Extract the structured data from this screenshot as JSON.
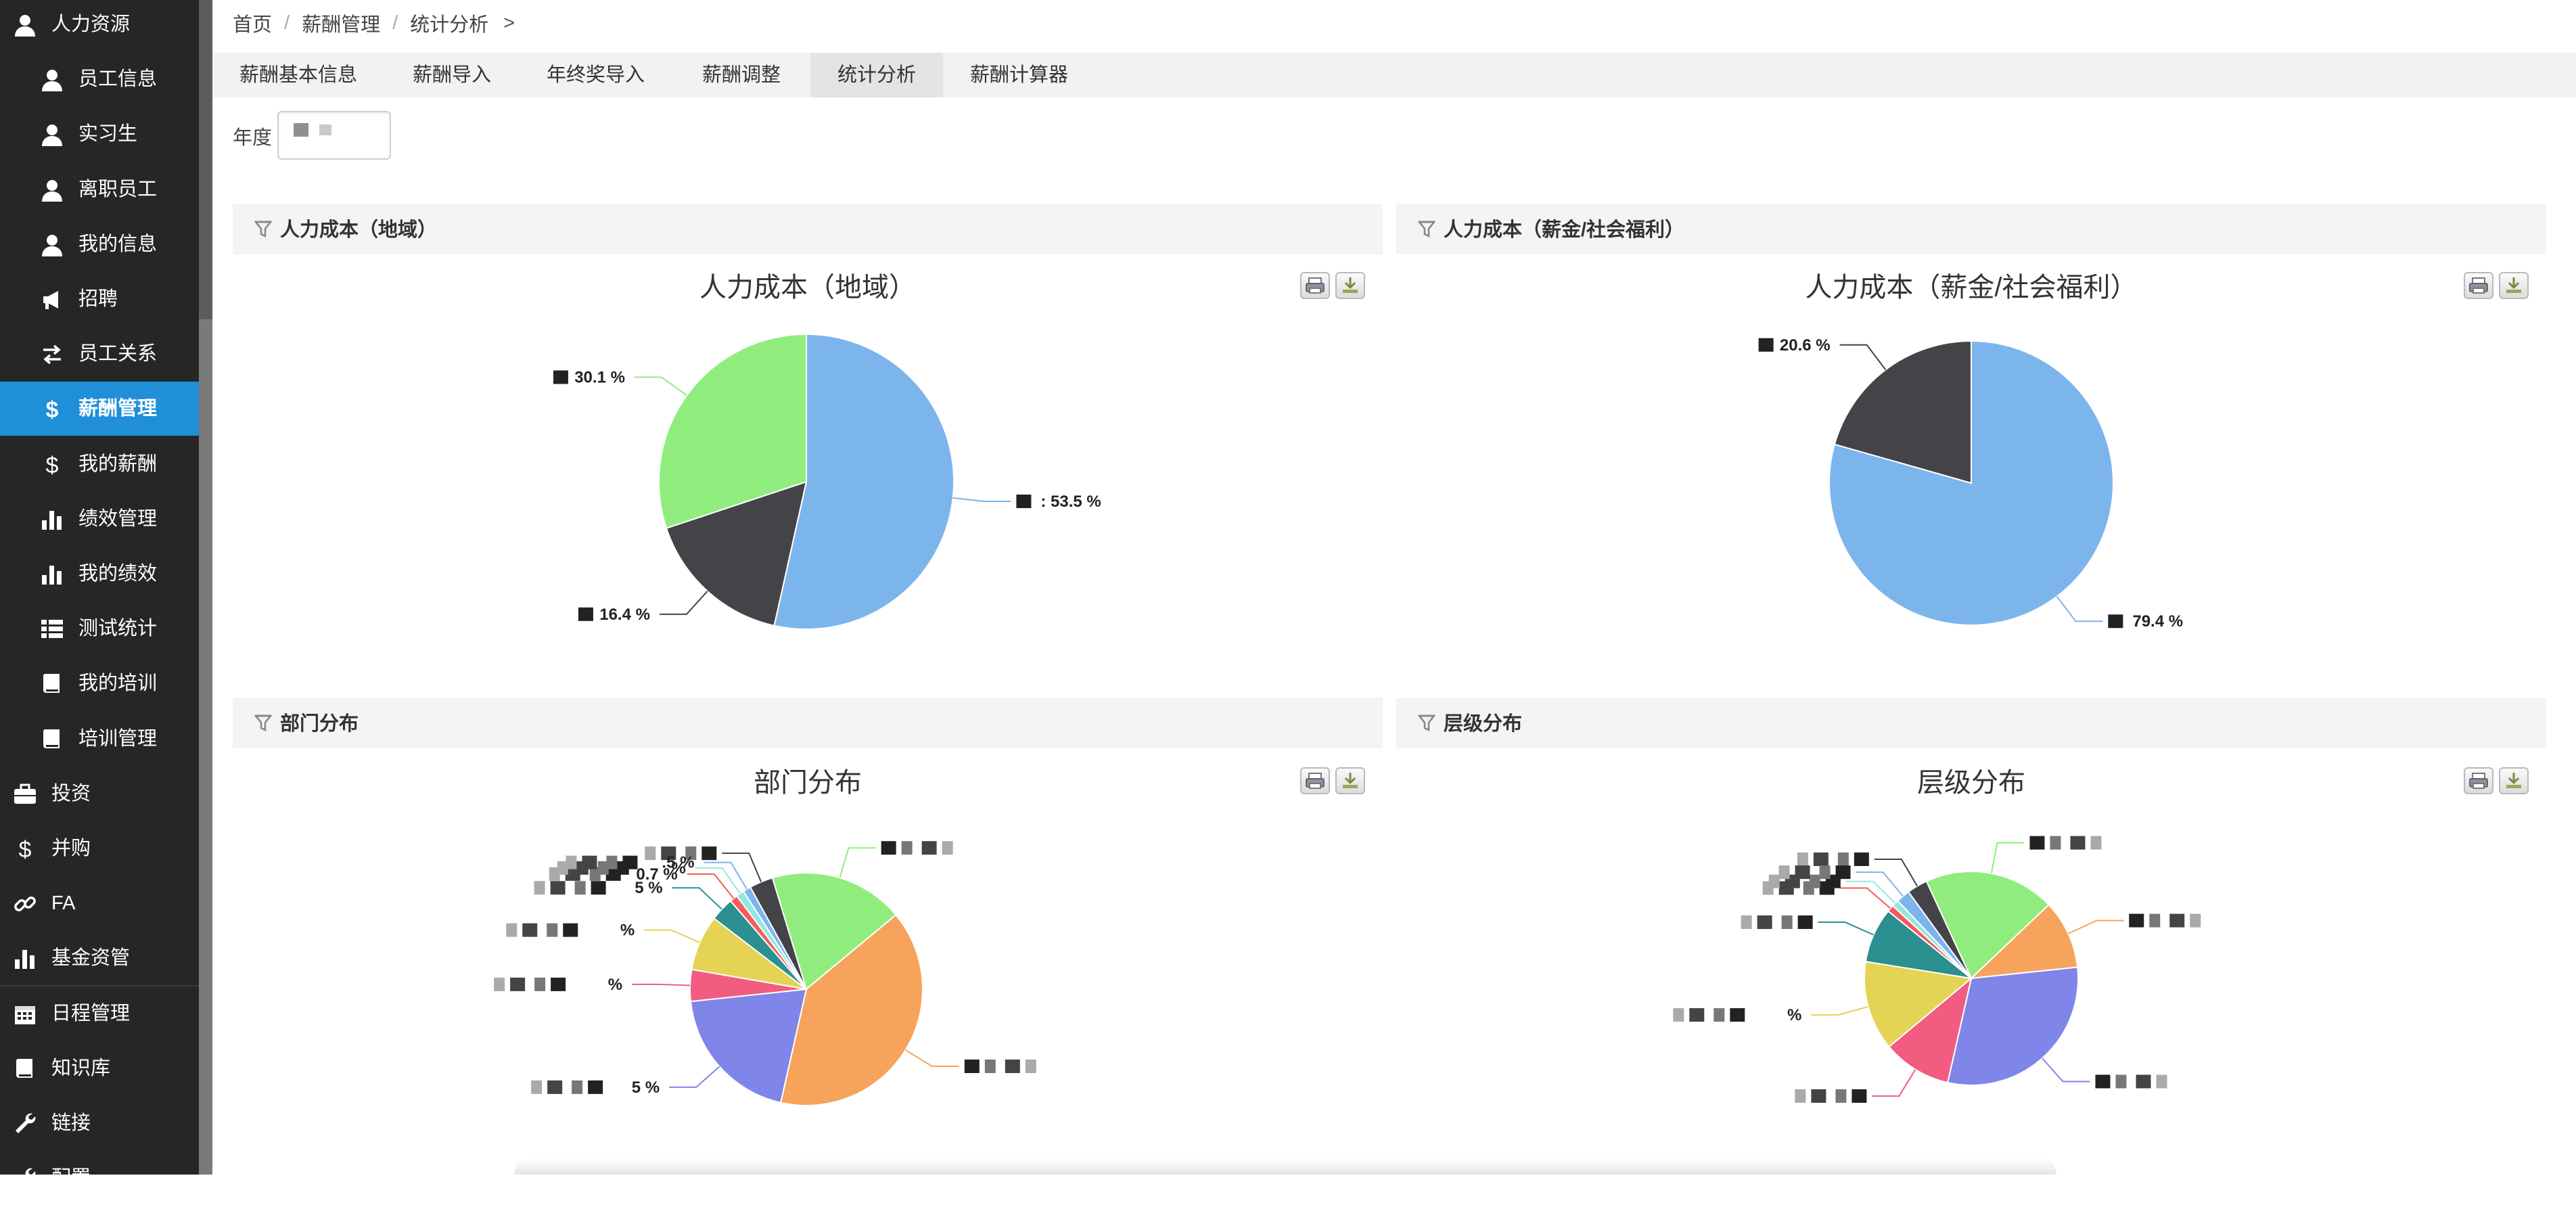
{
  "sidebar": {
    "items": [
      {
        "label": "人力资源",
        "icon": "user-icon",
        "level": "top"
      },
      {
        "label": "员工信息",
        "icon": "user-icon",
        "level": "sub"
      },
      {
        "label": "实习生",
        "icon": "user-icon",
        "level": "sub"
      },
      {
        "label": "离职员工",
        "icon": "user-icon",
        "level": "sub"
      },
      {
        "label": "我的信息",
        "icon": "user-icon",
        "level": "sub"
      },
      {
        "label": "招聘",
        "icon": "megaphone-icon",
        "level": "sub"
      },
      {
        "label": "员工关系",
        "icon": "exchange-icon",
        "level": "sub"
      },
      {
        "label": "薪酬管理",
        "icon": "dollar-icon",
        "level": "sub",
        "active": true
      },
      {
        "label": "我的薪酬",
        "icon": "dollar-icon",
        "level": "sub"
      },
      {
        "label": "绩效管理",
        "icon": "bar-chart-icon",
        "level": "sub"
      },
      {
        "label": "我的绩效",
        "icon": "bar-chart-icon",
        "level": "sub"
      },
      {
        "label": "测试统计",
        "icon": "list-icon",
        "level": "sub"
      },
      {
        "label": "我的培训",
        "icon": "book-icon",
        "level": "sub"
      },
      {
        "label": "培训管理",
        "icon": "book-icon",
        "level": "sub"
      },
      {
        "label": "投资",
        "icon": "briefcase-icon",
        "level": "top"
      },
      {
        "label": "并购",
        "icon": "dollar-icon",
        "level": "top"
      },
      {
        "label": "FA",
        "icon": "link-icon",
        "level": "top"
      },
      {
        "label": "基金资管",
        "icon": "bar-chart-icon",
        "level": "top"
      },
      {
        "label": "日程管理",
        "icon": "calendar-icon",
        "level": "top"
      },
      {
        "label": "知识库",
        "icon": "book-icon",
        "level": "top"
      },
      {
        "label": "链接",
        "icon": "wrench-icon",
        "level": "top"
      },
      {
        "label": "配置",
        "icon": "wrench-icon",
        "level": "top"
      }
    ],
    "active_color": "#1f8fd8"
  },
  "breadcrumb": {
    "items": [
      "首页",
      "薪酬管理",
      "统计分析"
    ],
    "separator": "/",
    "tail": ">"
  },
  "tabs": [
    {
      "label": "薪酬基本信息"
    },
    {
      "label": "薪酬导入"
    },
    {
      "label": "年终奖导入"
    },
    {
      "label": "薪酬调整"
    },
    {
      "label": "统计分析",
      "active": true
    },
    {
      "label": "薪酬计算器"
    }
  ],
  "filter": {
    "year_label": "年度"
  },
  "panels": [
    {
      "header": "人力成本（地域）",
      "title": "人力成本（地域）"
    },
    {
      "header": "人力成本（薪金/社会福利）",
      "title": "人力成本（薪金/社会福利）"
    },
    {
      "header": "部门分布",
      "title": "部门分布"
    },
    {
      "header": "层级分布",
      "title": "层级分布"
    }
  ],
  "chart_data": [
    {
      "type": "pie",
      "title": "人力成本（地域）",
      "series": [
        {
          "values": [
            53.5,
            16.4,
            30.1
          ]
        }
      ],
      "labels": [
        ": 53.5 %",
        "16.4 %",
        "30.1 %"
      ],
      "colors": [
        "#7cb5ec",
        "#434348",
        "#90ed7d"
      ]
    },
    {
      "type": "pie",
      "title": "人力成本（薪金/社会福利）",
      "series": [
        {
          "values": [
            79.4,
            20.6
          ]
        }
      ],
      "labels": [
        "79.4 %",
        "20.6 %"
      ],
      "colors": [
        "#7cb5ec",
        "#434348"
      ]
    },
    {
      "type": "pie",
      "title": "部门分布",
      "series": [
        {
          "values": [
            3,
            17,
            36,
            18,
            4,
            7,
            3,
            1,
            1,
            1
          ]
        }
      ],
      "labels": [
        "",
        "",
        "",
        "5 %",
        "%",
        "%",
        "5 %",
        "0.7 %",
        "%",
        ".5 %"
      ],
      "colors": [
        "#434348",
        "#90ed7d",
        "#f7a35c",
        "#8085e9",
        "#f15c80",
        "#e4d354",
        "#2b908f",
        "#f45b5b",
        "#91e8e1",
        "#7cb5ec"
      ]
    },
    {
      "type": "pie",
      "title": "层级分布",
      "series": [
        {
          "values": [
            3,
            19,
            10,
            29,
            10,
            13,
            8,
            1,
            1,
            2
          ]
        }
      ],
      "labels": [
        "",
        "",
        "",
        "",
        "",
        "%",
        "",
        "",
        "",
        ""
      ],
      "colors": [
        "#434348",
        "#90ed7d",
        "#f7a35c",
        "#8085e9",
        "#f15c80",
        "#e4d354",
        "#2b908f",
        "#f45b5b",
        "#91e8e1",
        "#7cb5ec"
      ]
    }
  ]
}
